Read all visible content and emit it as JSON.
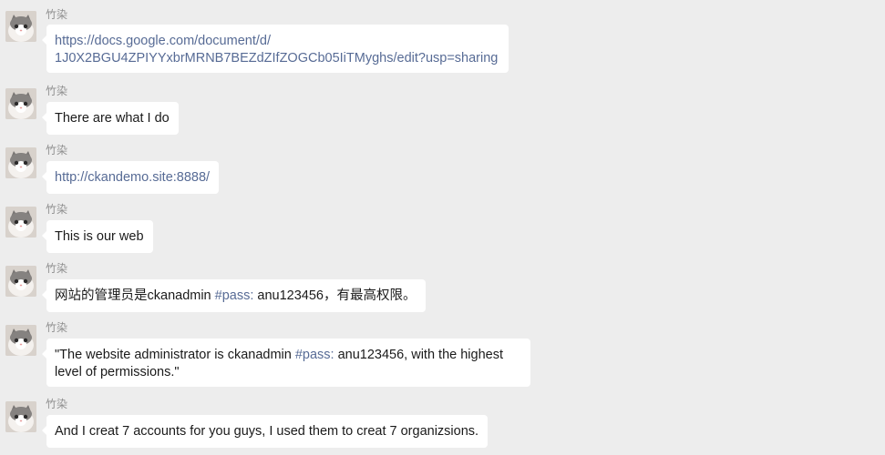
{
  "chat": {
    "messages": [
      {
        "sender": "竹染",
        "avatar_icon": "cat-avatar-icon",
        "lines": [
          "https://docs.google.com/document/d/",
          "1J0X2BGU4ZPIYYxbrMRNB7BEZdZIfZOGCb05IiTMyghs/edit?usp=sharing"
        ]
      },
      {
        "sender": "竹染",
        "avatar_icon": "cat-avatar-icon",
        "text": "There are what I do"
      },
      {
        "sender": "竹染",
        "avatar_icon": "cat-avatar-icon",
        "link": "http://ckandemo.site:8888/"
      },
      {
        "sender": "竹染",
        "avatar_icon": "cat-avatar-icon",
        "text": "This is our web"
      },
      {
        "sender": "竹染",
        "avatar_icon": "cat-avatar-icon",
        "pre": "网站的管理员是ckanadmin ",
        "tag": "#pass:",
        "post": " anu123456，有最高权限。"
      },
      {
        "sender": "竹染",
        "avatar_icon": "cat-avatar-icon",
        "pre": "\"The website administrator is ckanadmin ",
        "tag": "#pass:",
        "post": " anu123456, with the highest",
        "line2": "level of permissions.\""
      },
      {
        "sender": "竹染",
        "avatar_icon": "cat-avatar-icon",
        "text": "And I creat 7 accounts for you guys, I used them to creat 7 organizsions."
      }
    ]
  },
  "colors": {
    "background": "#ededed",
    "bubble": "#ffffff",
    "link": "#576b95",
    "sender": "#8f8f8f"
  }
}
